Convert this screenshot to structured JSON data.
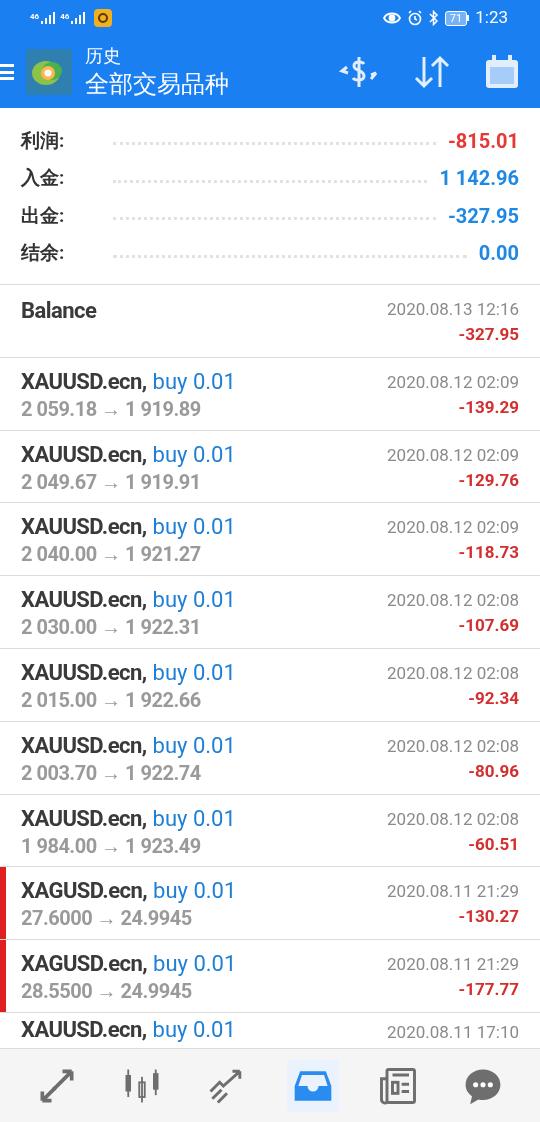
{
  "status_bar": {
    "signal_labels": [
      "46",
      "46"
    ],
    "battery": "71",
    "time": "1:23"
  },
  "app_bar": {
    "title": "历史",
    "subtitle": "全部交易品种"
  },
  "summary": [
    {
      "label": "利润:",
      "value": "-815.01",
      "color": "#e53935"
    },
    {
      "label": "入金:",
      "value": "1 142.96",
      "color": "#1e88e5"
    },
    {
      "label": "出金:",
      "value": "-327.95",
      "color": "#1e88e5"
    },
    {
      "label": "结余:",
      "value": "0.00",
      "color": "#1e88e5"
    }
  ],
  "entries": [
    {
      "kind": "balance",
      "title": "Balance",
      "time": "2020.08.13 12:16",
      "profit": "-327.95",
      "flagged": false
    },
    {
      "kind": "trade",
      "symbol": "XAUUSD.ecn,",
      "order": "buy 0.01",
      "prices": "2 059.18 → 1 919.89",
      "time": "2020.08.12 02:09",
      "profit": "-139.29",
      "flagged": false
    },
    {
      "kind": "trade",
      "symbol": "XAUUSD.ecn,",
      "order": "buy 0.01",
      "prices": "2 049.67 → 1 919.91",
      "time": "2020.08.12 02:09",
      "profit": "-129.76",
      "flagged": false
    },
    {
      "kind": "trade",
      "symbol": "XAUUSD.ecn,",
      "order": "buy 0.01",
      "prices": "2 040.00 → 1 921.27",
      "time": "2020.08.12 02:09",
      "profit": "-118.73",
      "flagged": false
    },
    {
      "kind": "trade",
      "symbol": "XAUUSD.ecn,",
      "order": "buy 0.01",
      "prices": "2 030.00 → 1 922.31",
      "time": "2020.08.12 02:08",
      "profit": "-107.69",
      "flagged": false
    },
    {
      "kind": "trade",
      "symbol": "XAUUSD.ecn,",
      "order": "buy 0.01",
      "prices": "2 015.00 → 1 922.66",
      "time": "2020.08.12 02:08",
      "profit": "-92.34",
      "flagged": false
    },
    {
      "kind": "trade",
      "symbol": "XAUUSD.ecn,",
      "order": "buy 0.01",
      "prices": "2 003.70 → 1 922.74",
      "time": "2020.08.12 02:08",
      "profit": "-80.96",
      "flagged": false
    },
    {
      "kind": "trade",
      "symbol": "XAUUSD.ecn,",
      "order": "buy 0.01",
      "prices": "1 984.00 → 1 923.49",
      "time": "2020.08.12 02:08",
      "profit": "-60.51",
      "flagged": false
    },
    {
      "kind": "trade",
      "symbol": "XAGUSD.ecn,",
      "order": "buy 0.01",
      "prices": "27.6000 → 24.9945",
      "time": "2020.08.11 21:29",
      "profit": "-130.27",
      "flagged": true
    },
    {
      "kind": "trade",
      "symbol": "XAGUSD.ecn,",
      "order": "buy 0.01",
      "prices": "28.5500 → 24.9945",
      "time": "2020.08.11 21:29",
      "profit": "-177.77",
      "flagged": true
    },
    {
      "kind": "partial",
      "symbol": "XAUUSD.ecn,",
      "order": "buy 0.01",
      "time": "2020.08.11 17:10",
      "flagged": false
    }
  ],
  "bottom_nav": [
    {
      "kind": "quotes",
      "selected": false
    },
    {
      "kind": "chart",
      "selected": false
    },
    {
      "kind": "trade",
      "selected": false
    },
    {
      "kind": "history",
      "selected": true
    },
    {
      "kind": "news",
      "selected": false
    },
    {
      "kind": "chat",
      "selected": false
    }
  ]
}
